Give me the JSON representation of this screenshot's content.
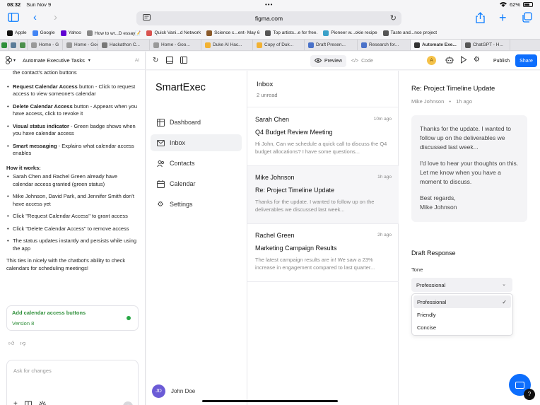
{
  "status": {
    "time": "08:32",
    "date": "Sun Nov 9",
    "battery": "62%"
  },
  "browser": {
    "url": "figma.com"
  },
  "bookmarks": [
    {
      "label": "Apple",
      "color": "#111111"
    },
    {
      "label": "Google",
      "color": "#4285f4"
    },
    {
      "label": "Yahoo",
      "color": "#6001d2"
    },
    {
      "label": "How to wr...D essay📝",
      "color": "#888888"
    },
    {
      "label": "Quick Vani...d Network",
      "color": "#d9534f"
    },
    {
      "label": "Science c...ent- May 6",
      "color": "#8a5a2b"
    },
    {
      "label": "Top artists...e for free.",
      "color": "#555555"
    },
    {
      "label": "Pioneer w...okie recipe",
      "color": "#3aa0c8"
    },
    {
      "label": "Taste and...nce project",
      "color": "#555555"
    }
  ],
  "tabs": [
    {
      "label": "",
      "color": "#2f8f3a",
      "mini": true
    },
    {
      "label": "",
      "color": "#5b7c99",
      "mini": true
    },
    {
      "label": "",
      "color": "#4b8f4b",
      "mini": true
    },
    {
      "label": "Home - G",
      "color": "#999999"
    },
    {
      "label": "Home - Goo...",
      "color": "#999999"
    },
    {
      "label": "Hackathon C...",
      "color": "#777777"
    },
    {
      "label": "Home - Goo...",
      "color": "#999999"
    },
    {
      "label": "Duke AI Hac...",
      "color": "#f2b233"
    },
    {
      "label": "Copy of Duk...",
      "color": "#f2b233"
    },
    {
      "label": "Draft Presen...",
      "color": "#4a72c9"
    },
    {
      "label": "Research for...",
      "color": "#4a72c9"
    },
    {
      "label": "Automate Exe...",
      "color": "#333333",
      "active": true
    },
    {
      "label": "ChatGPT - H...",
      "color": "#555555"
    }
  ],
  "chat": {
    "title": "Automate Executive Tasks",
    "ai_label": "AI",
    "intro_tail": "the contact's action buttons",
    "bullets1": [
      {
        "bold": "Request Calendar Access",
        "text": " button - Click to request access to view someone's calendar"
      },
      {
        "bold": "Delete Calendar Access",
        "text": " button - Appears when you have access, click to revoke it"
      },
      {
        "bold": "Visual status indicator",
        "text": " - Green badge shows when you have calendar access"
      },
      {
        "bold": "Smart messaging",
        "text": " - Explains what calendar access enables"
      }
    ],
    "how_title": "How it works:",
    "bullets2": [
      "Sarah Chen and Rachel Green already have calendar access granted (green status)",
      "Mike Johnson, David Park, and Jennifer Smith don't have access yet",
      "Click \"Request Calendar Access\" to grant access",
      "Click \"Delete Calendar Access\" to remove access",
      "The status updates instantly and persists while using the app"
    ],
    "closing": "This ties in nicely with the chatbot's ability to check calendars for scheduling meetings!",
    "version_title": "Add calendar access buttons",
    "version_label": "Version 8",
    "ask_placeholder": "Ask for changes"
  },
  "figma": {
    "preview_label": "Preview",
    "code_label": "Code",
    "avatar_initial": "A",
    "publish_label": "Publish",
    "share_label": "Share"
  },
  "app": {
    "brand": "SmartExec",
    "nav": [
      "Dashboard",
      "Inbox",
      "Contacts",
      "Calendar",
      "Settings"
    ],
    "user_initials": "JD",
    "user_name": "John Doe",
    "inbox_title": "Inbox",
    "inbox_unread": "2 unread",
    "messages": [
      {
        "from": "Sarah Chen",
        "when": "10m ago",
        "subject": "Q4 Budget Review Meeting",
        "snippet": "Hi John, Can we schedule a quick call to discuss the Q4 budget allocations? I have some questions..."
      },
      {
        "from": "Mike Johnson",
        "when": "1h ago",
        "subject": "Re: Project Timeline Update",
        "snippet": "Thanks for the update. I wanted to follow up on the deliverables we discussed last week..."
      },
      {
        "from": "Rachel Green",
        "when": "2h ago",
        "subject": "Marketing Campaign Results",
        "snippet": "The latest campaign results are in! We saw a 23% increase in engagement compared to last quarter..."
      }
    ],
    "detail": {
      "subject": "Re: Project Timeline Update",
      "from": "Mike Johnson",
      "when": "1h ago",
      "body1": "Thanks for the update. I wanted to follow up on the deliverables we discussed last week...",
      "body2": "I'd love to hear your thoughts on this. Let me know when you have a moment to discuss.",
      "sign1": "Best regards,",
      "sign2": "Mike Johnson",
      "draft_title": "Draft Response",
      "tone_label": "Tone",
      "tone_value": "Professional",
      "tone_options": [
        "Professional",
        "Friendly",
        "Concise"
      ]
    }
  }
}
